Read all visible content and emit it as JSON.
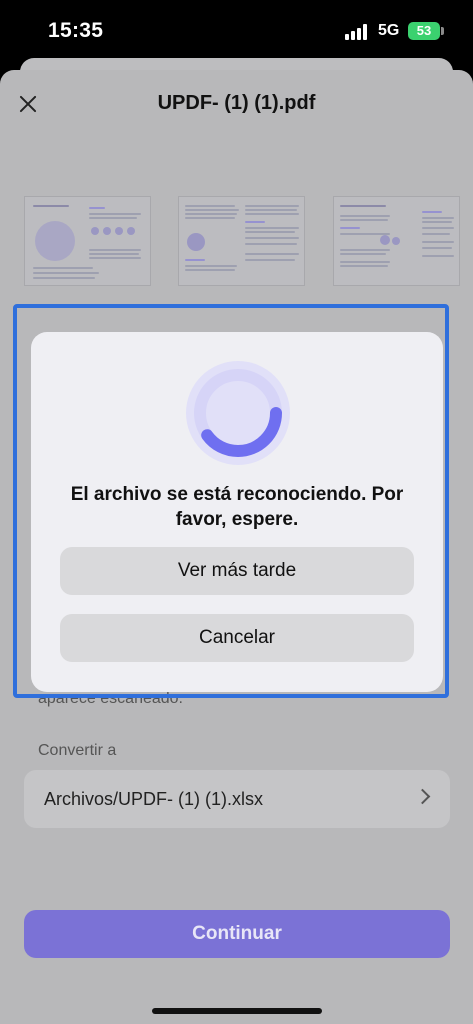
{
  "status_bar": {
    "time": "15:35",
    "network": "5G",
    "battery": "53"
  },
  "sheet": {
    "title": "UPDF- (1) (1).pdf",
    "partial_text": "aparece escaneado.",
    "convert_label": "Convertir a",
    "convert_path": "Archivos/UPDF- (1) (1).xlsx",
    "continue_label": "Continuar"
  },
  "dialog": {
    "message": "El archivo se está reconociendo. Por favor, espere.",
    "later_label": "Ver más tarde",
    "cancel_label": "Cancelar",
    "spinner_progress": 0.4
  },
  "colors": {
    "accent": "#7b72d6",
    "highlight": "#2f6fdc",
    "spinner": "#6f6ff0",
    "spinner_track": "#d6d4f7",
    "battery": "#3bd16f"
  },
  "icons": [
    "close-icon",
    "chevron-right-icon",
    "loading-spinner-icon",
    "signal-icon",
    "battery-icon"
  ]
}
